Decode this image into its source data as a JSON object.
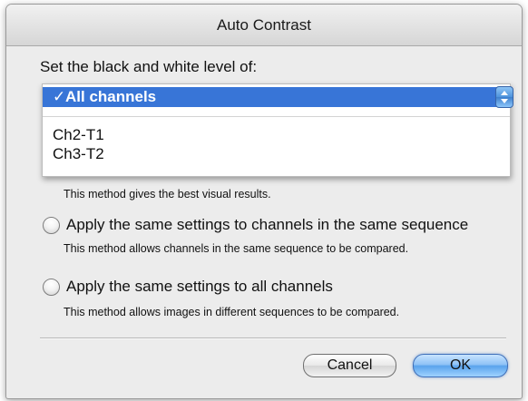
{
  "window": {
    "title": "Auto Contrast"
  },
  "prompt": "Set the black and white level of:",
  "popup": {
    "selected": "All channels",
    "items": [
      "Ch2-T1",
      "Ch3-T2"
    ],
    "check_glyph": "✓"
  },
  "options": [
    {
      "label": "",
      "description": "This method gives the best visual results.",
      "selected": false
    },
    {
      "label": "Apply the same settings to channels in the same sequence",
      "description": "This method allows channels in the same sequence to be compared.",
      "selected": false
    },
    {
      "label": "Apply the same settings to all channels",
      "description": "This method allows images in different sequences to be compared.",
      "selected": false
    }
  ],
  "buttons": {
    "cancel": "Cancel",
    "ok": "OK"
  },
  "colors": {
    "menu_highlight": "#3875d7",
    "default_button": "#5aa3ec"
  },
  "icons": {
    "popup_arrows": "up-down-arrows-icon"
  }
}
